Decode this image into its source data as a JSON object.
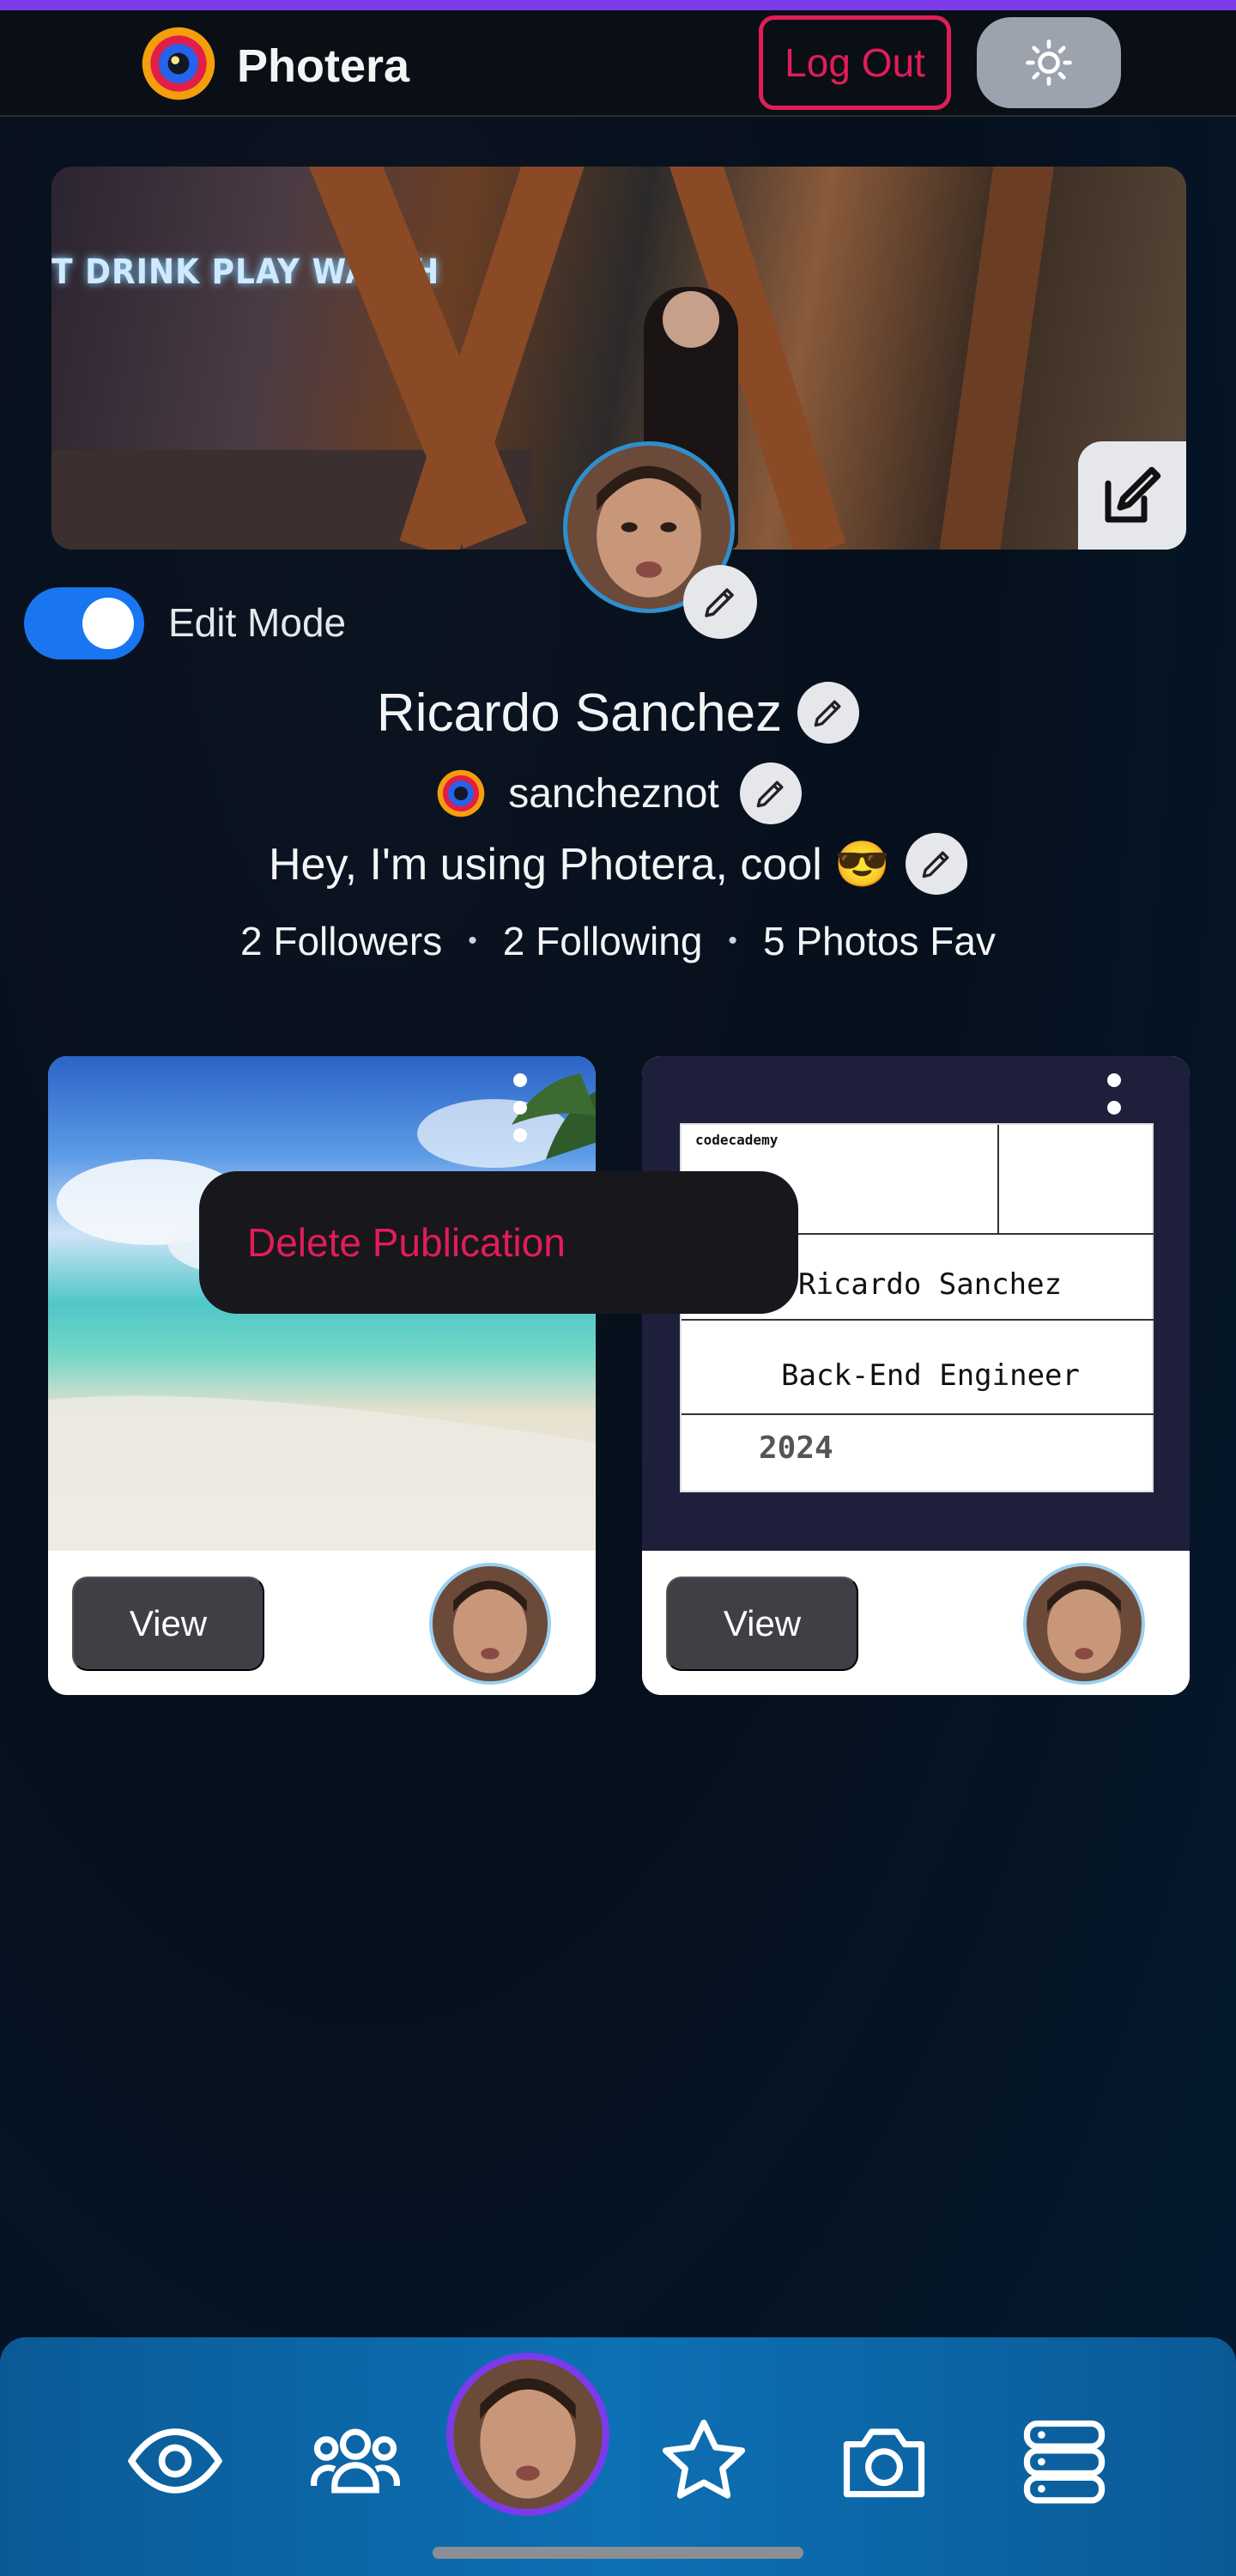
{
  "app": {
    "brand": "Photera",
    "logout_label": "Log Out"
  },
  "profile": {
    "edit_mode_label": "Edit Mode",
    "edit_mode_on": true,
    "name": "Ricardo Sanchez",
    "username": "sancheznot",
    "bio": "Hey, I'm using Photera, cool 😎",
    "followers": "2 Followers",
    "following": "2 Following",
    "photos_fav": "5 Photos Fav",
    "cover_sign_text": "T DRINK PLAY WATCH"
  },
  "cards": [
    {
      "view_label": "View"
    },
    {
      "view_label": "View",
      "certificate": {
        "name": "Ricardo Sanchez",
        "role": "Back-End Engineer",
        "year": "2024",
        "issuer": "codecademy"
      }
    }
  ],
  "context_menu": {
    "delete_label": "Delete Publication"
  },
  "bottom_nav": {
    "items": [
      "eye-icon",
      "community-icon",
      "profile-avatar",
      "star-icon",
      "camera-icon",
      "server-icon"
    ]
  },
  "colors": {
    "accent": "#7c3aed",
    "danger": "#e11d58",
    "toggle": "#1976f0",
    "nav": "#0d70b4"
  }
}
